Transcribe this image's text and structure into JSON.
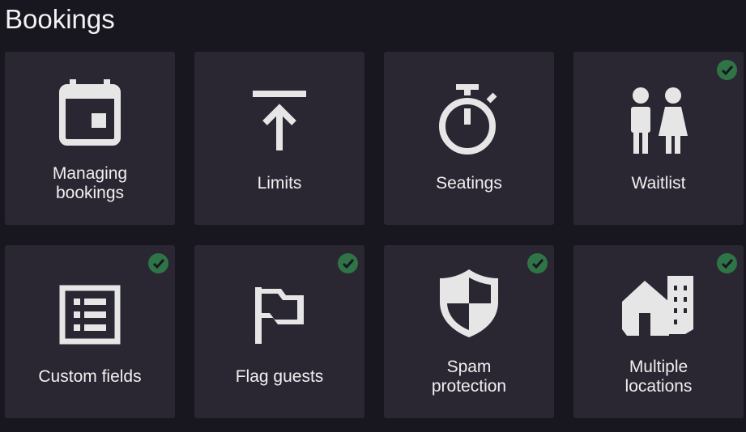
{
  "page": {
    "title": "Bookings"
  },
  "colors": {
    "background": "#18161f",
    "tile": "#2a2733",
    "icon": "#e6e6e6",
    "check": "#2f7447"
  },
  "tiles": [
    {
      "label_line1": "Managing",
      "label_line2": "bookings",
      "icon": "calendar-icon",
      "enabled": false
    },
    {
      "label_line1": "Limits",
      "label_line2": "",
      "icon": "upload-limit-icon",
      "enabled": false
    },
    {
      "label_line1": "Seatings",
      "label_line2": "",
      "icon": "stopwatch-icon",
      "enabled": false
    },
    {
      "label_line1": "Waitlist",
      "label_line2": "",
      "icon": "people-icon",
      "enabled": true
    },
    {
      "label_line1": "Custom fields",
      "label_line2": "",
      "icon": "form-list-icon",
      "enabled": true
    },
    {
      "label_line1": "Flag guests",
      "label_line2": "",
      "icon": "flag-icon",
      "enabled": true
    },
    {
      "label_line1": "Spam",
      "label_line2": "protection",
      "icon": "shield-icon",
      "enabled": true
    },
    {
      "label_line1": "Multiple",
      "label_line2": "locations",
      "icon": "buildings-icon",
      "enabled": true
    }
  ]
}
